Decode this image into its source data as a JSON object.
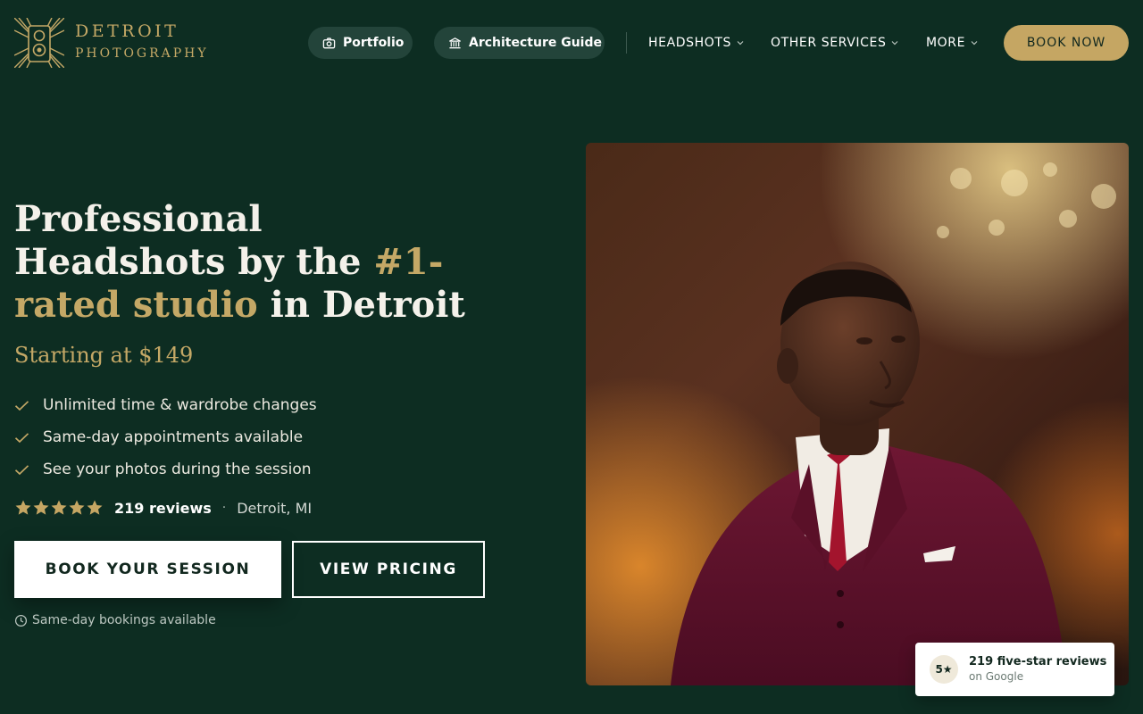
{
  "brand": {
    "line1": "DETROIT",
    "line2": "PHOTOGRAPHY",
    "logo_icon": "camera-sunburst-icon",
    "accent_color": "#c4a866"
  },
  "nav": {
    "portfolio_label": "Portfolio",
    "portfolio_icon": "camera-icon",
    "architecture_label": "Architecture Guide",
    "architecture_icon": "building-columns-icon",
    "items": [
      {
        "label": "HEADSHOTS",
        "icon": "chevron-down-icon"
      },
      {
        "label": "OTHER SERVICES",
        "icon": "chevron-down-icon"
      },
      {
        "label": "MORE",
        "icon": "chevron-down-icon"
      }
    ],
    "book_now_label": "BOOK NOW"
  },
  "hero": {
    "headline_part1": "Professional Headshots by the ",
    "headline_accent": "#1-rated studio",
    "headline_part2": " in Detroit",
    "starting_price": "Starting at $149",
    "features": [
      "Unlimited time & wardrobe changes",
      "Same-day appointments available",
      "See your photos during the session"
    ],
    "rating_stars": 5,
    "reviews_label": "219 reviews",
    "separator": "·",
    "location": "Detroit, MI",
    "primary_cta": "BOOK YOUR SESSION",
    "secondary_cta": "VIEW PRICING",
    "note": "Same-day bookings available",
    "note_icon": "clock-icon"
  },
  "review_card": {
    "badge": "5★",
    "title": "219 five-star reviews",
    "subtitle": "on Google"
  },
  "colors": {
    "background": "#0d2d22",
    "gold": "#c5a663",
    "pill": "#23443a"
  }
}
